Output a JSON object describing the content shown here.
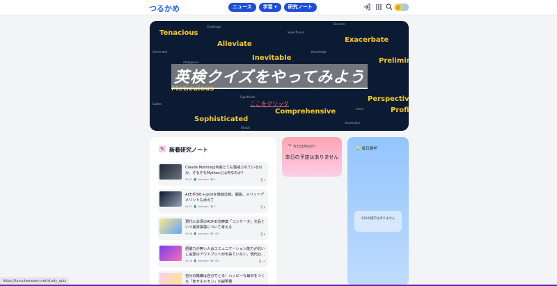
{
  "header": {
    "logo": "つるかめ",
    "nav": [
      "ニュース",
      "学習 ▾",
      "研究ノート"
    ],
    "icons": [
      "login-icon",
      "apps-grid-icon",
      "search-icon",
      "theme-toggle"
    ]
  },
  "hero": {
    "title": "英検クイズをやってみよう",
    "link": "ここをクリック",
    "words_big": [
      "Tenacious",
      "Alleviate",
      "Exacerbate",
      "Inevitable",
      "Preliminary",
      "Meticulous",
      "Perspective",
      "Comprehensive",
      "Sophisticated",
      "Proficient"
    ],
    "words_small": [
      "Challenge",
      "Superfluous",
      "Discrete",
      "Ambiguous",
      "Knowledge",
      "Acquire",
      "Significant",
      "Subtle",
      "Vocabulary",
      "Global",
      "Learn",
      "Persuade",
      "Generated"
    ]
  },
  "notes": {
    "title": "新着研究ノート",
    "items": [
      {
        "title": "Claude Mythosは何故とても警戒されているのか、そもそもMythosとは何なのか？",
        "date": "05.07",
        "author": "unknown",
        "views": "4",
        "count": "4"
      },
      {
        "title": "AI王手3社＋grokを徹底比較。解説、メリットデメリットも添えて",
        "date": "05.07",
        "author": "unknown",
        "views": "7",
        "count": "8"
      },
      {
        "title": "現代に必須のADHD治療薬「コンサータ」欠品という異常事態について考える",
        "date": "02.06",
        "author": "unknown",
        "views": "330",
        "count": "8"
      },
      {
        "title": "語彙力が無い人はコミュニケーション能力が低いし言葉のアウトプットが出来ていない、現代社…",
        "date": "02.26",
        "author": "unknown",
        "views": "335",
        "count": "12"
      },
      {
        "title": "自分の機嫌は自分でとる！ハッピーな毎日をつくる「幸せホルモン」の説明書",
        "date": "",
        "author": "",
        "views": "",
        "count": ""
      }
    ]
  },
  "today": {
    "title": "今日は何の日？",
    "body": "本日の予定はありません"
  },
  "trivia": {
    "title": "毎日雑学",
    "empty": "今日の雑学はありません"
  },
  "status": {
    "url": "https://tsurutamezen.net/study_quiz"
  },
  "colors": {
    "brand": "#2563eb",
    "nav_pill": "#1d4ed8",
    "hero_bg": "#0b1b33",
    "hero_word": "#facc15",
    "hero_link": "#f87171",
    "today_bg": "#fda4af",
    "trivia_bg": "#93c5fd",
    "bottom_bar": "#6b21a8"
  }
}
